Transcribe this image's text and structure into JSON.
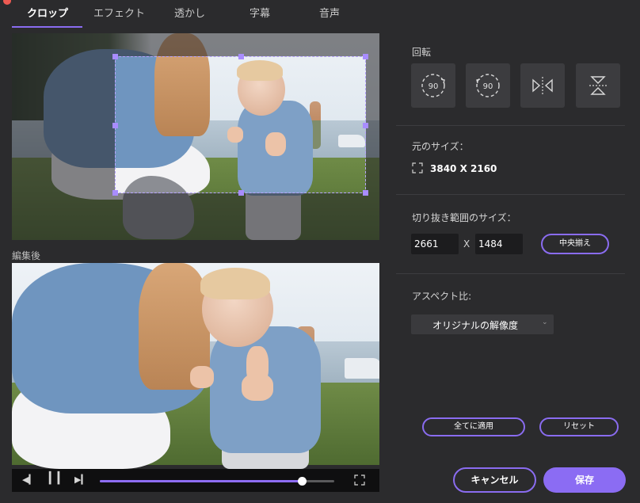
{
  "tabs": [
    {
      "label": "クロップ",
      "active": true
    },
    {
      "label": "エフェクト",
      "active": false
    },
    {
      "label": "透かし",
      "active": false
    },
    {
      "label": "字幕",
      "active": false
    },
    {
      "label": "音声",
      "active": false
    }
  ],
  "preview": {
    "edited_label": "編集後",
    "playback_progress": 0.86
  },
  "rotation": {
    "title": "回転",
    "buttons": [
      {
        "name": "rotate-right-90",
        "text": "90"
      },
      {
        "name": "rotate-left-90",
        "text": "90"
      },
      {
        "name": "flip-horizontal",
        "text": ""
      },
      {
        "name": "flip-vertical",
        "text": ""
      }
    ]
  },
  "original_size": {
    "title": "元のサイズ：",
    "value": "3840 X 2160"
  },
  "crop_size": {
    "title": "切り抜き範囲のサイズ：",
    "width": "2661",
    "separator": "X",
    "height": "1484",
    "center_label": "中央揃え"
  },
  "aspect": {
    "title": "アスペクト比:",
    "selected": "オリジナルの解像度"
  },
  "actions": {
    "apply_all": "全てに適用",
    "reset": "リセット",
    "cancel": "キャンセル",
    "save": "保存"
  },
  "colors": {
    "accent": "#8a6cf0",
    "background": "#2b2b2d",
    "panel_button": "#3c3c3f"
  }
}
